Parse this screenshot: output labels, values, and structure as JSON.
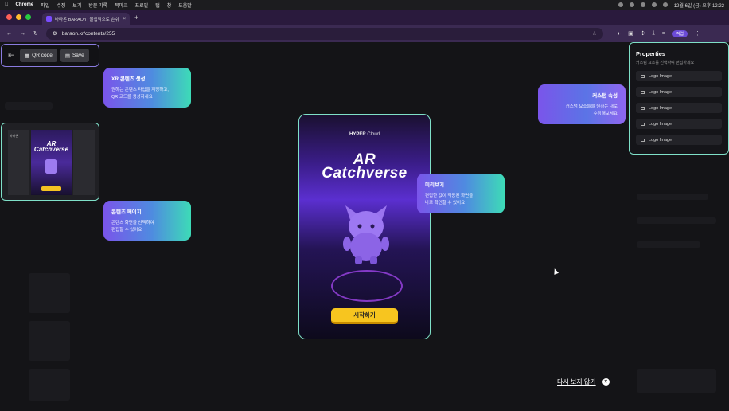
{
  "menubar": {
    "app": "Chrome",
    "items": [
      "파일",
      "수정",
      "보기",
      "방문 기록",
      "북마크",
      "프로필",
      "탭",
      "창",
      "도움말"
    ],
    "clock": "12월 6일 (금) 오후 12:22"
  },
  "tab": {
    "title": "바라온 BARAOn | 몰입적으로 손쉬"
  },
  "address": {
    "url": "baraon.kr/contents/255",
    "profile": "작업"
  },
  "toolbar": {
    "qr_label": "QR code",
    "save_label": "Save"
  },
  "tips": {
    "xr": {
      "title": "XR 콘텐츠 생성",
      "body": [
        "원하는 콘텐츠 타입을 지정하고,",
        "QR 코드를 생성하세요"
      ]
    },
    "page": {
      "title": "콘텐츠 페이지",
      "body": [
        "콘텐츠 화면을 선택하여",
        "편집할 수 있어요"
      ]
    },
    "preview": {
      "title": "미리보기",
      "body": [
        "편집한 값이 적용된 화면을",
        "바로 확인할 수 있어요"
      ]
    },
    "custom": {
      "title": "커스텀 속성",
      "body": [
        "커스텀 요소들을 원하는 대로",
        "수정해보세요"
      ]
    }
  },
  "thumb": {
    "tag": "바라온",
    "title": "AR Catchverse"
  },
  "phone": {
    "brand_bold": "HYPER",
    "brand_rest": "Cloud",
    "title_line1": "AR",
    "title_line2": "Catchverse",
    "start": "시작하기"
  },
  "properties": {
    "title": "Properties",
    "subtitle": "커스텀 요소를 선택하여 편집하세요",
    "items": [
      "Logo Image",
      "Logo Image",
      "Logo Image",
      "Logo Image",
      "Logo Image"
    ]
  },
  "dismiss": {
    "label": "다시 보지 않기"
  }
}
